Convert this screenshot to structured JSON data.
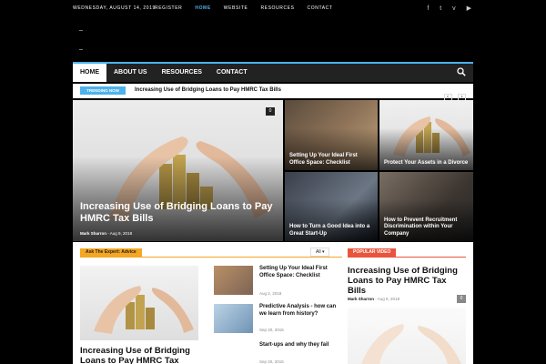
{
  "topbar": {
    "date": "WEDNESDAY, AUGUST 14, 2019",
    "links": [
      "REGISTER",
      "HOME",
      "WEBSITE",
      "RESOURCES",
      "CONTACT"
    ],
    "social_icons": [
      "facebook-icon",
      "twitter-icon",
      "vimeo-icon",
      "youtube-icon"
    ]
  },
  "nav": {
    "items": [
      "HOME",
      "ABOUT US",
      "RESOURCES",
      "CONTACT"
    ],
    "active": "HOME"
  },
  "trending": {
    "badge": "TRENDING NOW",
    "headline": "Increasing Use of Bridging Loans to Pay HMRC Tax Bills",
    "prev": "‹",
    "next": "›"
  },
  "grid": {
    "main": {
      "title": "Increasing Use of Bridging Loans to Pay HMRC Tax Bills",
      "author": "Mark Sharron",
      "separator": "-",
      "date": "Aug 9, 2018",
      "comments": "0"
    },
    "tiles": [
      {
        "title": "Setting Up Your Ideal First Office Space: Checklist"
      },
      {
        "title": "Protect Your Assets in a Divorce"
      },
      {
        "title": "How to Turn a Good Idea into a Great Start-Up"
      },
      {
        "title": "How to Prevent Recruitment Discrimination within Your Company"
      }
    ]
  },
  "lower": {
    "expert_badge": "Ask The Expert: Advice",
    "filter": "All",
    "featured_title": "Increasing Use of Bridging Loans to Pay HMRC Tax",
    "list": [
      {
        "title": "Setting Up Your Ideal First Office Space: Checklist",
        "date": "Aug 2, 2018"
      },
      {
        "title": "Predictive Analysis - how can we learn from history?",
        "date": "Sep 20, 2015"
      },
      {
        "title": "Start-ups and why they fail",
        "date": "Sep 20, 2015"
      }
    ],
    "popular_badge": "POPULAR VIDEO",
    "popular_title": "Increasing Use of Bridging Loans to Pay HMRC Tax Bills",
    "popular_author": "Mark Sharron",
    "popular_separator": "-",
    "popular_date": "Aug 9, 2018",
    "popular_comments": "0"
  },
  "colors": {
    "accent": "#4db2ec",
    "expert": "#f5a623",
    "popular": "#e8553c",
    "nav_bg": "#222222"
  }
}
